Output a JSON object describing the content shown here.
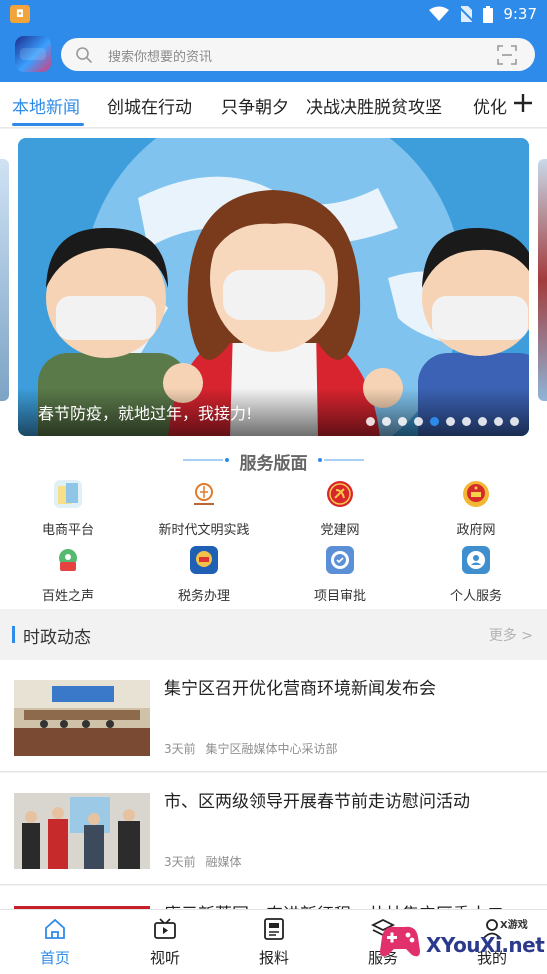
{
  "status_bar": {
    "time": "9:37"
  },
  "search": {
    "placeholder": "搜索你想要的资讯"
  },
  "tabs": [
    {
      "label": "本地新闻",
      "active": true
    },
    {
      "label": "创城在行动"
    },
    {
      "label": "只争朝夕"
    },
    {
      "label": "决战决胜脱贫攻坚"
    },
    {
      "label": "优化"
    }
  ],
  "banner": {
    "caption": "春节防疫，就地过年，我接力!",
    "slide_count": 10,
    "active_slide": 5
  },
  "services": {
    "title": "服务版面",
    "items": [
      {
        "label": "电商平台",
        "icon": "ecommerce-icon"
      },
      {
        "label": "新时代文明实践",
        "icon": "civilization-icon"
      },
      {
        "label": "党建网",
        "icon": "party-emblem-icon"
      },
      {
        "label": "政府网",
        "icon": "national-emblem-icon"
      },
      {
        "label": "百姓之声",
        "icon": "voice-icon"
      },
      {
        "label": "税务办理",
        "icon": "tax-icon"
      },
      {
        "label": "项目审批",
        "icon": "approval-icon"
      },
      {
        "label": "个人服务",
        "icon": "personal-service-icon"
      }
    ]
  },
  "news": {
    "section_title": "时政动态",
    "more_label": "更多 >",
    "items": [
      {
        "title": "集宁区召开优化营商环境新闻发布会",
        "time": "3天前",
        "source": "集宁区融媒体中心采访部"
      },
      {
        "title": "市、区两级领导开展春节前走访慰问活动",
        "time": "3天前",
        "source": "融媒体"
      },
      {
        "title": "赓元新蒂国，奋进新征程，共林集宁区委十二",
        "time": "",
        "source": ""
      }
    ]
  },
  "bottom_nav": [
    {
      "label": "首页",
      "icon": "home-icon",
      "active": true
    },
    {
      "label": "视听",
      "icon": "video-icon"
    },
    {
      "label": "报料",
      "icon": "report-icon"
    },
    {
      "label": "服务",
      "icon": "service-icon"
    },
    {
      "label": "我的",
      "icon": "profile-icon"
    }
  ],
  "watermark": {
    "badge": "X游戏",
    "text": "XYouXi.net"
  },
  "colors": {
    "primary": "#2f8bea",
    "text": "#222222",
    "muted": "#8f8f8f"
  }
}
